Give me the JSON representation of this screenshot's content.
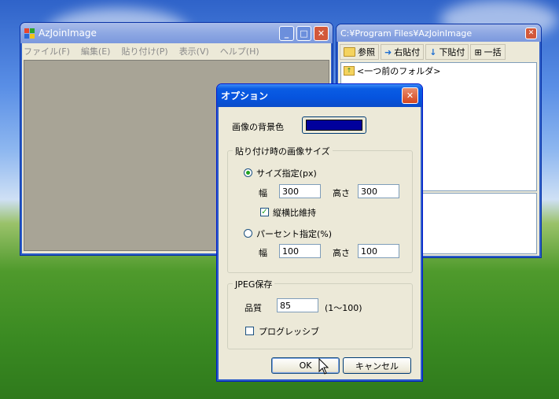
{
  "main_window": {
    "title": "AzJoinImage",
    "menu": [
      "ファイル(F)",
      "編集(E)",
      "貼り付け(P)",
      "表示(V)",
      "ヘルプ(H)"
    ]
  },
  "browser_window": {
    "title": "C:¥Program Files¥AzJoinImage",
    "toolbar": {
      "browse": "参照",
      "paste_right": "右貼付",
      "paste_down": "下貼付",
      "batch": "一括"
    },
    "list_items": [
      "<一つ前のフォルダ>"
    ]
  },
  "options_dialog": {
    "title": "オプション",
    "bg_color_label": "画像の背景色",
    "bg_color": "#00009c",
    "paste_group": {
      "legend": "貼り付け時の画像サイズ",
      "size_radio": "サイズ指定(px)",
      "size_selected": true,
      "width_label": "幅",
      "width_value": "300",
      "height_label": "高さ",
      "height_value": "300",
      "keep_ratio_label": "縦横比維持",
      "keep_ratio_checked": true,
      "percent_radio": "パーセント指定(%)",
      "percent_width_label": "幅",
      "percent_width_value": "100",
      "percent_height_label": "高さ",
      "percent_height_value": "100"
    },
    "jpeg_group": {
      "legend": "JPEG保存",
      "quality_label": "品質",
      "quality_value": "85",
      "quality_range": "(1～100)",
      "progressive_label": "プログレッシブ",
      "progressive_checked": false
    },
    "ok_label": "OK",
    "cancel_label": "キャンセル"
  }
}
